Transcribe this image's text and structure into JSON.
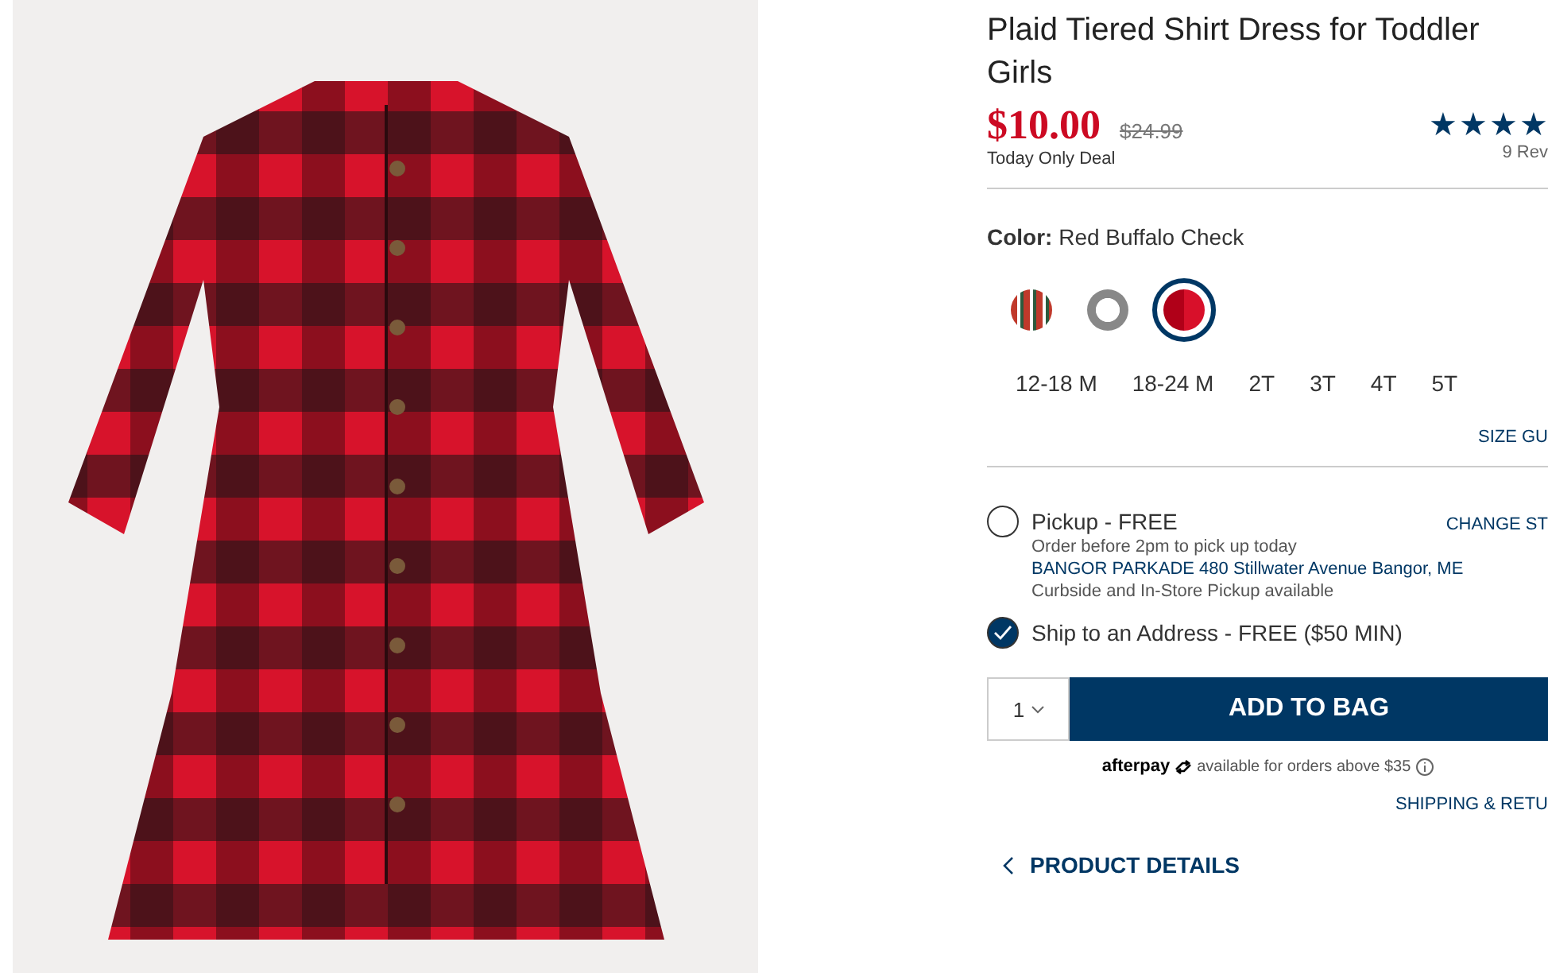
{
  "product": {
    "title": "Plaid Tiered Shirt Dress for Toddler Girls",
    "price": "$10.00",
    "original_price": "$24.99",
    "deal": "Today Only Deal",
    "stars": 4,
    "reviews": "9 Rev"
  },
  "color": {
    "label": "Color:",
    "value": "Red Buffalo Check",
    "swatches": [
      {
        "kind": "tartan",
        "selected": false
      },
      {
        "kind": "gray",
        "selected": false
      },
      {
        "kind": "red",
        "selected": true
      }
    ]
  },
  "sizes": [
    {
      "label": "12-18 M",
      "selected": false
    },
    {
      "label": "18-24 M",
      "selected": false
    },
    {
      "label": "2T",
      "selected": false
    },
    {
      "label": "3T",
      "selected": false
    },
    {
      "label": "4T",
      "selected": false
    },
    {
      "label": "5T",
      "selected": false
    }
  ],
  "size_guide": "SIZE GU",
  "delivery": [
    {
      "label": "Pickup - FREE",
      "selected": false,
      "action": "CHANGE ST",
      "lines": [
        {
          "kind": "note",
          "text": "Order before 2pm to pick up today"
        },
        {
          "kind": "link",
          "text": "BANGOR PARKADE 480 Stillwater Avenue  Bangor, ME"
        },
        {
          "kind": "note",
          "text": "Curbside and In-Store Pickup available"
        }
      ]
    },
    {
      "label": "Ship to an Address - FREE ($50 MIN)",
      "selected": true
    }
  ],
  "quantity": "1",
  "add_button": "ADD TO BAG",
  "afterpay": {
    "brand": "afterpay",
    "text": "available for orders above $35"
  },
  "shipping_link": "SHIPPING & RETU",
  "details": "PRODUCT DETAILS"
}
